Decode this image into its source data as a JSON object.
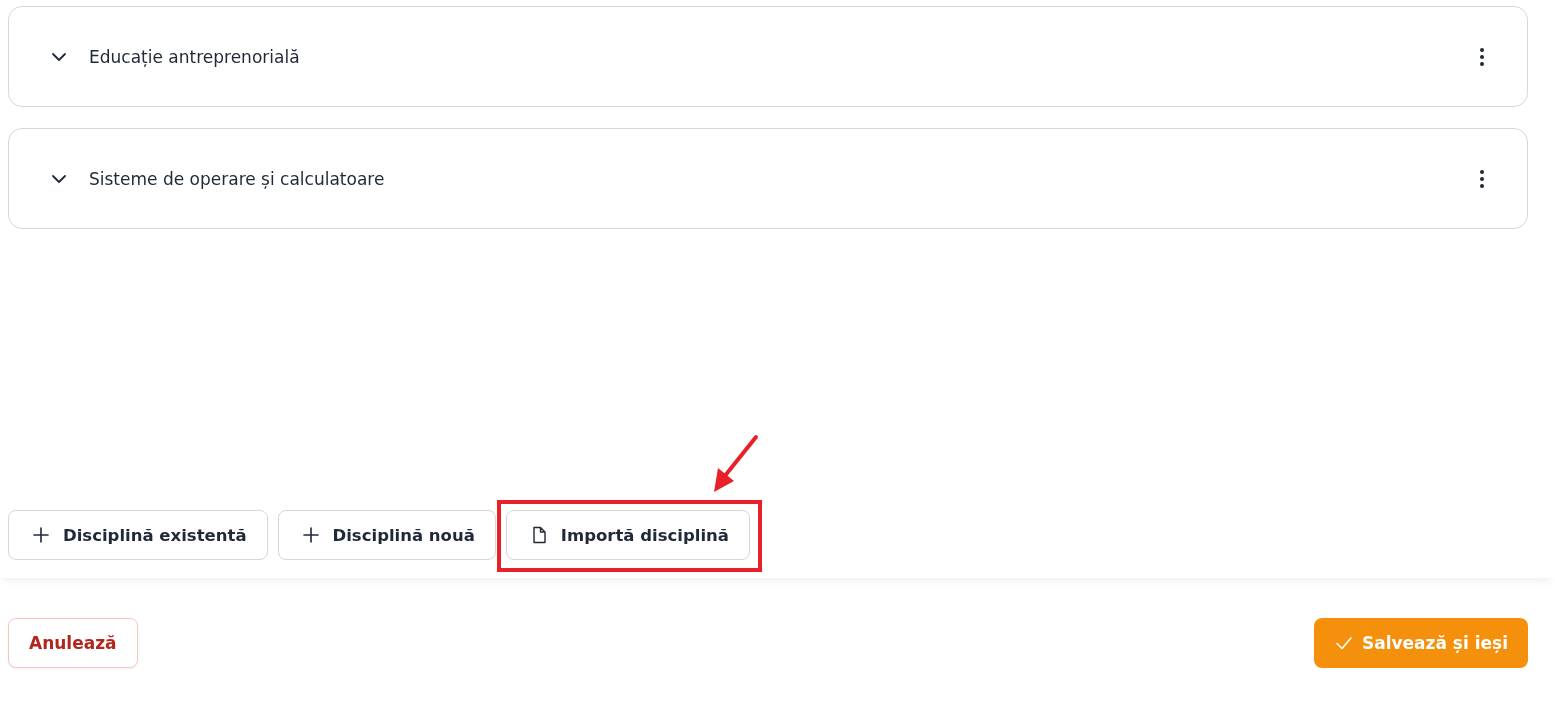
{
  "disciplines": [
    {
      "name": "Educație antreprenorială",
      "expanded": false
    },
    {
      "name": "Sisteme de operare și calculatoare",
      "expanded": false
    }
  ],
  "actions": [
    {
      "label": "Disciplină existentă",
      "kind": "add",
      "highlighted": false
    },
    {
      "label": "Disciplină nouă",
      "kind": "add",
      "highlighted": false
    },
    {
      "label": "Importă disciplină",
      "kind": "import",
      "highlighted": true
    }
  ],
  "footer": {
    "cancel": "Anulează",
    "save": "Salvează și ieși"
  }
}
